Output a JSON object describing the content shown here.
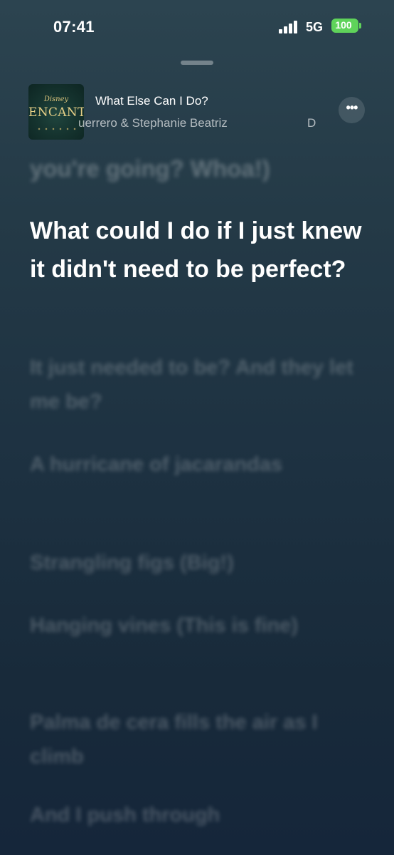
{
  "status_bar": {
    "time": "07:41",
    "network": "5G",
    "battery": "100"
  },
  "now_playing": {
    "album": {
      "brand": "Disney",
      "title": "ENCANTO"
    },
    "title": "What Else Can I Do?",
    "artist": "uerrero & Stephanie Beatriz",
    "artist_trailing": "D"
  },
  "lyrics": {
    "previous": "you're going? Whoa!)",
    "current": "What could I do if I just knew it didn't need to be perfect?",
    "upcoming": [
      {
        "text": "It just needed to be? And they let me be?"
      },
      {
        "text": "A hurricane of jacarandas"
      },
      {
        "text": "Strangling figs (Big!)"
      },
      {
        "text": "Hanging vines (This is fine)"
      },
      {
        "text": "Palma de cera fills the air as I climb"
      },
      {
        "text": "And I push through"
      }
    ]
  },
  "colors": {
    "background_top": "#2c4450",
    "background_bottom": "#15263a",
    "battery": "#5fd35a"
  },
  "icons": {
    "more": "ellipsis-icon",
    "signal": "cellular-signal-icon",
    "battery": "battery-charging-icon"
  }
}
